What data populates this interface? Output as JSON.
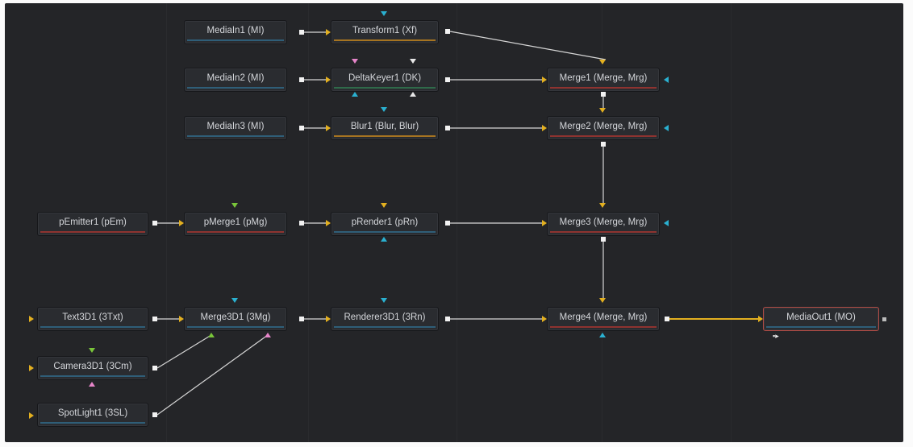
{
  "nodes": [
    {
      "id": "mediain1",
      "label": "MediaIn1  (MI)"
    },
    {
      "id": "transform1",
      "label": "Transform1  (Xf)"
    },
    {
      "id": "mediain2",
      "label": "MediaIn2  (MI)"
    },
    {
      "id": "deltakeyer1",
      "label": "DeltaKeyer1  (DK)"
    },
    {
      "id": "merge1",
      "label": "Merge1  (Merge, Mrg)"
    },
    {
      "id": "mediain3",
      "label": "MediaIn3  (MI)"
    },
    {
      "id": "blur1",
      "label": "Blur1  (Blur, Blur)"
    },
    {
      "id": "merge2",
      "label": "Merge2  (Merge, Mrg)"
    },
    {
      "id": "pemitter1",
      "label": "pEmitter1  (pEm)"
    },
    {
      "id": "pmerge1",
      "label": "pMerge1  (pMg)"
    },
    {
      "id": "prender1",
      "label": "pRender1  (pRn)"
    },
    {
      "id": "merge3",
      "label": "Merge3  (Merge, Mrg)"
    },
    {
      "id": "text3d1",
      "label": "Text3D1  (3Txt)"
    },
    {
      "id": "merge3d1",
      "label": "Merge3D1  (3Mg)"
    },
    {
      "id": "renderer3d1",
      "label": "Renderer3D1  (3Rn)"
    },
    {
      "id": "merge4",
      "label": "Merge4  (Merge, Mrg)"
    },
    {
      "id": "mediaout1",
      "label": "MediaOut1  (MO)"
    },
    {
      "id": "camera3d1",
      "label": "Camera3D1  (3Cm)"
    },
    {
      "id": "spotlight1",
      "label": "SpotLight1  (3SL)"
    }
  ],
  "connections": [
    [
      "mediain1",
      "transform1"
    ],
    [
      "transform1",
      "merge1"
    ],
    [
      "mediain2",
      "deltakeyer1"
    ],
    [
      "deltakeyer1",
      "merge1"
    ],
    [
      "mediain3",
      "blur1"
    ],
    [
      "blur1",
      "merge2"
    ],
    [
      "merge1",
      "merge2"
    ],
    [
      "merge2",
      "merge3"
    ],
    [
      "pemitter1",
      "pmerge1"
    ],
    [
      "pmerge1",
      "prender1"
    ],
    [
      "prender1",
      "merge3"
    ],
    [
      "merge3",
      "merge4"
    ],
    [
      "text3d1",
      "merge3d1"
    ],
    [
      "camera3d1",
      "merge3d1"
    ],
    [
      "spotlight1",
      "merge3d1"
    ],
    [
      "merge3d1",
      "renderer3d1"
    ],
    [
      "renderer3d1",
      "merge4"
    ],
    [
      "merge4",
      "mediaout1"
    ]
  ],
  "viewer_indicator": "▪▸",
  "colors": {
    "canvas": "#242528",
    "wire": "#d6d6d6",
    "active_wire": "#e3b020",
    "input_arrow": "#e3b020",
    "mask_input": "#2ab0d0"
  }
}
